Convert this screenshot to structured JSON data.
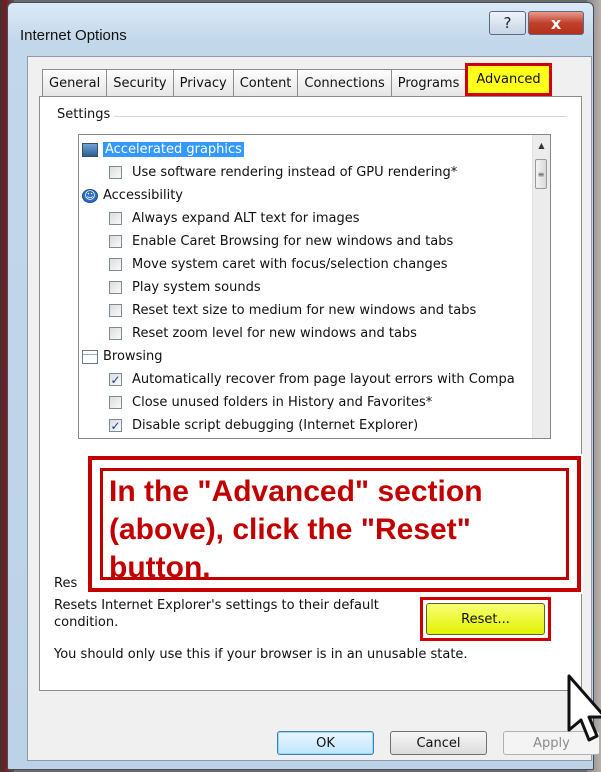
{
  "window": {
    "title": "Internet Options",
    "help_label": "?",
    "close_label": "x"
  },
  "tabs": [
    {
      "label": "General",
      "active": false
    },
    {
      "label": "Security",
      "active": false
    },
    {
      "label": "Privacy",
      "active": false
    },
    {
      "label": "Content",
      "active": false
    },
    {
      "label": "Connections",
      "active": false
    },
    {
      "label": "Programs",
      "active": false
    },
    {
      "label": "Advanced",
      "active": true
    }
  ],
  "settings": {
    "group_label": "Settings",
    "rows": [
      {
        "kind": "category",
        "icon": "monitor-icon",
        "label": "Accelerated graphics",
        "selected": true
      },
      {
        "kind": "checkbox",
        "label": "Use software rendering instead of GPU rendering*",
        "checked": false
      },
      {
        "kind": "category",
        "icon": "accessibility-icon",
        "label": "Accessibility",
        "selected": false
      },
      {
        "kind": "checkbox",
        "label": "Always expand ALT text for images",
        "checked": false
      },
      {
        "kind": "checkbox",
        "label": "Enable Caret Browsing for new windows and tabs",
        "checked": false
      },
      {
        "kind": "checkbox",
        "label": "Move system caret with focus/selection changes",
        "checked": false
      },
      {
        "kind": "checkbox",
        "label": "Play system sounds",
        "checked": false
      },
      {
        "kind": "checkbox",
        "label": "Reset text size to medium for new windows and tabs",
        "checked": false
      },
      {
        "kind": "checkbox",
        "label": "Reset zoom level for new windows and tabs",
        "checked": false
      },
      {
        "kind": "category",
        "icon": "browsing-icon",
        "label": "Browsing",
        "selected": false
      },
      {
        "kind": "checkbox",
        "label": "Automatically recover from page layout errors with Compa",
        "checked": true
      },
      {
        "kind": "checkbox",
        "label": "Close unused folders in History and Favorites*",
        "checked": false
      },
      {
        "kind": "checkbox",
        "label": "Disable script debugging (Internet Explorer)",
        "checked": true
      }
    ]
  },
  "callout": {
    "text": "In the \"Advanced\" section (above), click the \"Reset\" button."
  },
  "reset": {
    "heading": "Res",
    "description": "Resets Internet Explorer's settings to their default condition.",
    "button_label": "Reset...",
    "warning": "You should only use this if your browser is in an unusable state."
  },
  "buttons": {
    "ok": "OK",
    "cancel": "Cancel",
    "apply": "Apply"
  },
  "colors": {
    "highlight_red": "#d10000",
    "highlight_yellow": "#ffff1a",
    "selection_blue": "#3399ff"
  }
}
